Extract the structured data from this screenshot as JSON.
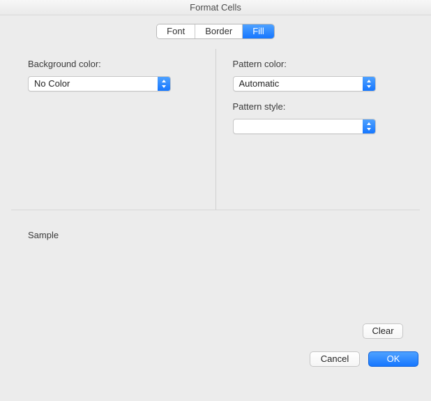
{
  "window": {
    "title": "Format Cells"
  },
  "tabs": {
    "font": "Font",
    "border": "Border",
    "fill": "Fill",
    "active": "fill"
  },
  "left": {
    "bg_label": "Background color:",
    "bg_value": "No Color"
  },
  "right": {
    "pcolor_label": "Pattern color:",
    "pcolor_value": "Automatic",
    "pstyle_label": "Pattern style:",
    "pstyle_value": ""
  },
  "sample": {
    "label": "Sample"
  },
  "buttons": {
    "clear": "Clear",
    "cancel": "Cancel",
    "ok": "OK"
  }
}
